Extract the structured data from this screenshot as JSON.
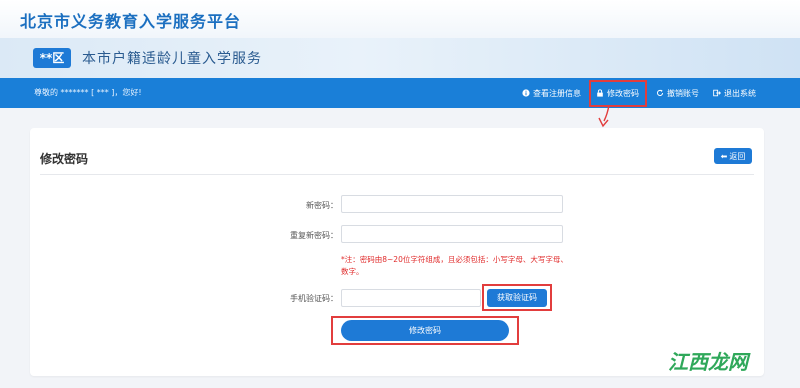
{
  "header": {
    "site_title": "北京市义务教育入学服务平台"
  },
  "banner": {
    "district": "**区",
    "title": "本市户籍适龄儿童入学服务"
  },
  "navbar": {
    "greeting": "尊敬的 ******* [ *** ]，您好!",
    "items": [
      {
        "label": "查看注册信息",
        "icon": "info-icon"
      },
      {
        "label": "修改密码",
        "icon": "lock-icon"
      },
      {
        "label": "撤销账号",
        "icon": "refresh-icon"
      },
      {
        "label": "退出系统",
        "icon": "logout-icon"
      }
    ]
  },
  "panel": {
    "title": "修改密码",
    "back_label": "返回",
    "fields": {
      "new_password_label": "新密码：",
      "new_password_value": "",
      "repeat_password_label": "重复新密码：",
      "repeat_password_value": "",
      "phone_code_label": "手机验证码：",
      "phone_code_value": ""
    },
    "note": "*注：密码由8~20位字符组成，且必须包括：小写字母、大写字母、数字。",
    "get_code_label": "获取验证码",
    "submit_label": "修改密码"
  },
  "watermark": "江西龙网",
  "colors": {
    "primary": "#1a7fd8",
    "highlight": "#e23d3d",
    "note": "#e02b2b"
  }
}
